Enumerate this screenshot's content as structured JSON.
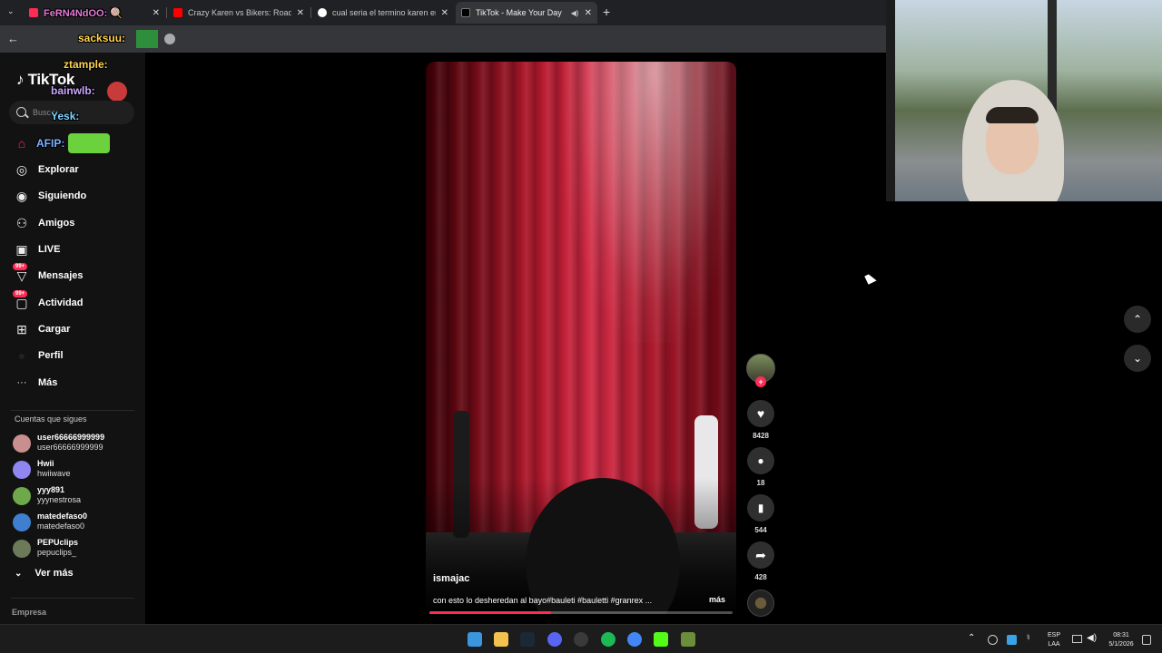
{
  "browser": {
    "tabs": [
      {
        "title": "FeRN4NdOO: 🍭",
        "icon_color": "#fe2c55"
      },
      {
        "title": "Crazy Karen vs Bikers: Road Rag",
        "icon_color": "#ff0000"
      },
      {
        "title": "cual seria el termino karen en e",
        "icon_color": "#4285f4"
      },
      {
        "title": "TikTok - Make Your Day",
        "icon_color": "#ffffff"
      }
    ],
    "new_tab": "+",
    "close": "✕",
    "overlay_texts": [
      "FeRN4NdOO:",
      "sacksuu:"
    ]
  },
  "sidebar": {
    "logo": "TikTok",
    "search_placeholder": "Buscar",
    "overlay_texts": [
      "ztample:",
      "bainwlb:",
      "Yesk:",
      "AFIP:"
    ],
    "nav": [
      {
        "label": "Para ti",
        "icon": "home-icon",
        "glyph": "⌂"
      },
      {
        "label": "Explorar",
        "icon": "compass-icon",
        "glyph": "◎"
      },
      {
        "label": "Siguiendo",
        "icon": "following-icon",
        "glyph": "◉"
      },
      {
        "label": "Amigos",
        "icon": "friends-icon",
        "glyph": "⚇"
      },
      {
        "label": "LIVE",
        "icon": "live-icon",
        "glyph": "▣"
      },
      {
        "label": "Mensajes",
        "icon": "messages-icon",
        "glyph": "▽",
        "badge": "99+"
      },
      {
        "label": "Actividad",
        "icon": "activity-icon",
        "glyph": "▢",
        "badge": "99+"
      },
      {
        "label": "Cargar",
        "icon": "upload-icon",
        "glyph": "⊞"
      },
      {
        "label": "Perfil",
        "icon": "profile-icon",
        "glyph": "●"
      },
      {
        "label": "Más",
        "icon": "more-icon",
        "glyph": "···"
      }
    ],
    "following_title": "Cuentas que sigues",
    "accounts": [
      {
        "name": "user66666999999",
        "username": "user66666999999",
        "color": "#c98f8f"
      },
      {
        "name": "Hwii",
        "username": "hwiiwave",
        "color": "#8f86f0"
      },
      {
        "name": "yyy891",
        "username": "yyynestrosa",
        "color": "#6fa84a"
      },
      {
        "name": "matedefaso0",
        "username": "matedefaso0",
        "color": "#3f7fd0"
      },
      {
        "name": "PEPUclips",
        "username": "pepuclips_",
        "color": "#6d7a5a"
      }
    ],
    "see_more": "Ver más",
    "footer": "Empresa"
  },
  "video": {
    "author": "ismajac",
    "caption": "con esto lo desheredan al bayo#bauleti #bauletti #granrex ...",
    "more": "más",
    "progress": 0.4
  },
  "actions": {
    "follow": "+",
    "likes": "8428",
    "comments": "18",
    "saves": "544",
    "shares": "428"
  },
  "feed_nav": {
    "up": "⌃",
    "down": "⌄"
  },
  "taskbar": {
    "apps": [
      {
        "name": "windows-start-icon",
        "color": "#3a96dd"
      },
      {
        "name": "file-explorer-icon",
        "color": "#f2c14e"
      },
      {
        "name": "steam-icon",
        "color": "#1b2838"
      },
      {
        "name": "discord-icon",
        "color": "#5865f2"
      },
      {
        "name": "obs-icon",
        "color": "#3a3a3a"
      },
      {
        "name": "spotify-icon",
        "color": "#1db954"
      },
      {
        "name": "chrome-icon",
        "color": "#4285f4"
      },
      {
        "name": "kick-icon",
        "color": "#53fc18"
      },
      {
        "name": "minecraft-icon",
        "color": "#6b8e3a"
      }
    ],
    "lang": "ESP",
    "lang_sub": "LAA",
    "time": "08:31",
    "date": "5/1/2026"
  }
}
